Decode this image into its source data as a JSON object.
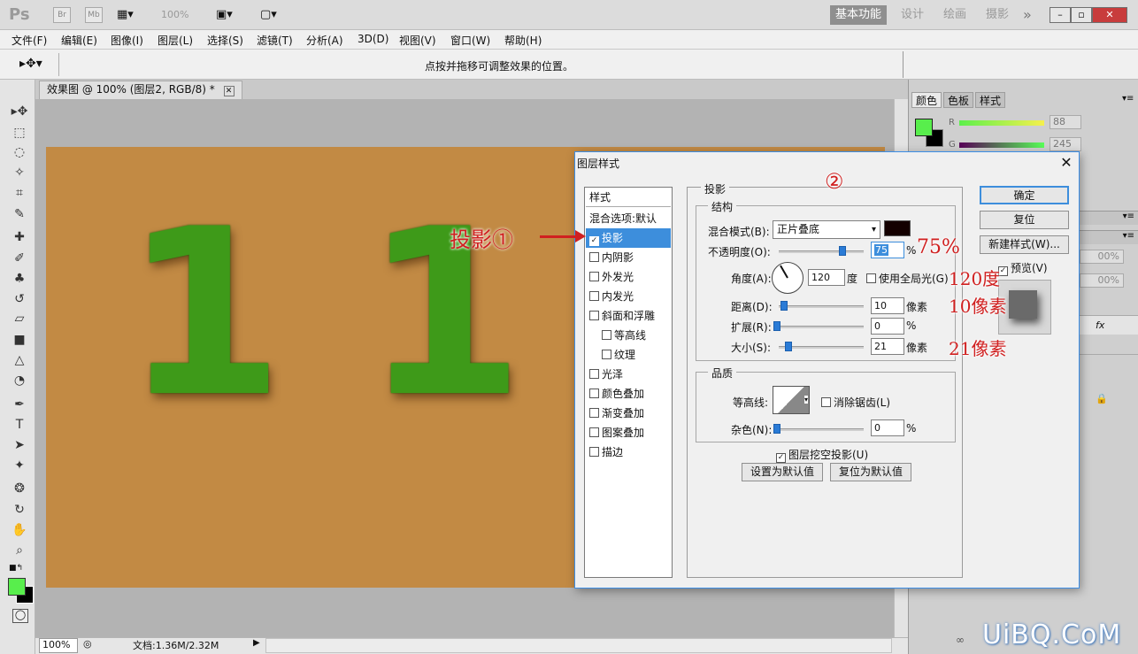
{
  "titlebar": {
    "logo": "Ps",
    "br": "Br",
    "mb": "Mb",
    "zoom": "100%",
    "workspaces": [
      "基本功能",
      "设计",
      "绘画",
      "摄影"
    ],
    "more": "»"
  },
  "menu": [
    "文件(F)",
    "编辑(E)",
    "图像(I)",
    "图层(L)",
    "选择(S)",
    "滤镜(T)",
    "分析(A)",
    "3D(D)",
    "视图(V)",
    "窗口(W)",
    "帮助(H)"
  ],
  "options": {
    "hint": "点按并拖移可调整效果的位置。"
  },
  "document": {
    "tab_label": "效果图 @ 100% (图层2, RGB/8) *",
    "canvas_text": "1 1 . 1"
  },
  "statusbar": {
    "zoom": "100%",
    "doc": "文档:1.36M/2.32M"
  },
  "panel": {
    "tabs": [
      "颜色",
      "色板",
      "样式"
    ],
    "r_label": "R",
    "r_value": "88",
    "g_label": "G",
    "g_value": "245",
    "layer_pct_1": "00%",
    "layer_pct_2": "00%",
    "fx": "fx"
  },
  "dialog": {
    "title": "图层样式",
    "close": "✕",
    "style_list": [
      {
        "label": "样式",
        "check": false,
        "header": true
      },
      {
        "label": "混合选项:默认",
        "check": false,
        "header": true
      },
      {
        "label": "投影",
        "check": true,
        "checked": true,
        "selected": true
      },
      {
        "label": "内阴影",
        "check": true
      },
      {
        "label": "外发光",
        "check": true
      },
      {
        "label": "内发光",
        "check": true
      },
      {
        "label": "斜面和浮雕",
        "check": true
      },
      {
        "label": "等高线",
        "check": true,
        "indent": true
      },
      {
        "label": "纹理",
        "check": true,
        "indent": true
      },
      {
        "label": "光泽",
        "check": true
      },
      {
        "label": "颜色叠加",
        "check": true
      },
      {
        "label": "渐变叠加",
        "check": true
      },
      {
        "label": "图案叠加",
        "check": true
      },
      {
        "label": "描边",
        "check": true
      }
    ],
    "section_title": "投影",
    "structure_title": "结构",
    "blend_mode_label": "混合模式(B):",
    "blend_mode_value": "正片叠底",
    "opacity_label": "不透明度(O):",
    "opacity_value": "75",
    "opacity_unit": "%",
    "opacity_pct": 75,
    "angle_label": "角度(A):",
    "angle_value": "120",
    "angle_unit": "度",
    "global_light_label": "使用全局光(G)",
    "distance_label": "距离(D):",
    "distance_value": "10",
    "distance_unit": "像素",
    "spread_label": "扩展(R):",
    "spread_value": "0",
    "spread_unit": "%",
    "size_label": "大小(S):",
    "size_value": "21",
    "size_unit": "像素",
    "quality_title": "品质",
    "contour_label": "等高线:",
    "antialias_label": "消除锯齿(L)",
    "noise_label": "杂色(N):",
    "noise_value": "0",
    "noise_unit": "%",
    "knockout_label": "图层挖空投影(U)",
    "set_default": "设置为默认值",
    "reset_default": "复位为默认值",
    "ok": "确定",
    "reset": "复位",
    "new_style": "新建样式(W)...",
    "preview_label": "预览(V)"
  },
  "annotations": {
    "shadow": "投影①",
    "circle2": "②",
    "opacity": "75%",
    "angle": "120度",
    "distance": "10像素",
    "size": "21像素"
  },
  "watermark": "UiBQ.CoM",
  "colors": {
    "foreground": "#58ee4c",
    "canvas": "#c28a44",
    "selection": "#3d8edc",
    "annotation": "#d02020",
    "grass": "#3e9a19"
  }
}
